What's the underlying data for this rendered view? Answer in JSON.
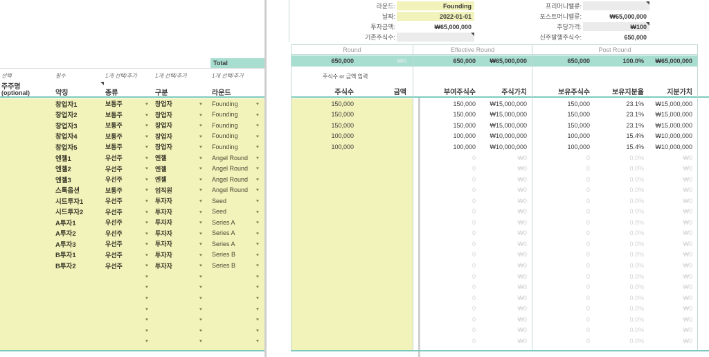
{
  "app": {
    "type": "spreadsheet",
    "colors": {
      "teal_band": "#a8ded0",
      "teal_rule": "#7ecbbd",
      "yellow_input": "#f2f2bb",
      "gray_input": "#ebebeb",
      "muted_text": "#c9c9c9"
    }
  },
  "round_panel": {
    "fields": [
      {
        "label": "라운드:",
        "value": "Founding",
        "style": "yellow",
        "dropdown": true
      },
      {
        "label": "날짜:",
        "value": "2022-01-01",
        "style": "yellow",
        "dropdown": false
      },
      {
        "label": "투자금액:",
        "value": "₩65,000,000",
        "style": "plain",
        "dropdown": false
      },
      {
        "label": "기존주식수:",
        "value": "",
        "style": "gray",
        "dropdown": false,
        "comment": true
      }
    ]
  },
  "valuation_panel": {
    "fields": [
      {
        "label": "프리머니밸류:",
        "value": "",
        "style": "gray",
        "comment": true
      },
      {
        "label": "포스트머니밸류:",
        "value": "₩65,000,000",
        "style": "plain",
        "comment": false
      },
      {
        "label": "주당가격:",
        "value": "₩100",
        "style": "gray",
        "comment": true
      },
      {
        "label": "신주발행주식수:",
        "value": "650,000",
        "style": "plain",
        "comment": false
      }
    ]
  },
  "left_headers": {
    "total_label": "Total",
    "hints": {
      "select": "선택",
      "required": "필수",
      "pick_or_add": "1개 선택/추가"
    },
    "columns": [
      {
        "hint": "선택",
        "title": "주주명",
        "subtitle": "(optional)"
      },
      {
        "hint": "필수",
        "title": "약칭",
        "subtitle": ""
      },
      {
        "hint": "1개 선택/추가",
        "title": "종류",
        "subtitle": ""
      },
      {
        "hint": "1개 선택/추가",
        "title": "구분",
        "subtitle": ""
      },
      {
        "hint": "1개 선택/추가",
        "title": "라운드",
        "subtitle": ""
      }
    ]
  },
  "groups": [
    {
      "name": "Round"
    },
    {
      "name": "Effective Round"
    },
    {
      "name": "Post Round"
    }
  ],
  "totals": {
    "round_shares": "650,000",
    "round_amount": "₩0",
    "effective_shares": "650,000",
    "effective_value": "₩65,000,000",
    "post_shares": "650,000",
    "post_percent": "100.0%",
    "post_value": "₩65,000,000"
  },
  "input_hint": "주식수 or 금액 입력",
  "right_headers": [
    "주식수",
    "금액",
    "부여주식수",
    "주식가치",
    "보유주식수",
    "보유지분율",
    "지분가치"
  ],
  "rows": [
    {
      "name": "창업자1",
      "kind": "보통주",
      "category": "창업자",
      "round": "Founding",
      "shares": "150,000",
      "amount": "",
      "eff_shares": "150,000",
      "eff_value": "₩15,000,000",
      "post_shares": "150,000",
      "post_percent": "23.1%",
      "post_value": "₩15,000,000",
      "empty": false
    },
    {
      "name": "창업자2",
      "kind": "보통주",
      "category": "창업자",
      "round": "Founding",
      "shares": "150,000",
      "amount": "",
      "eff_shares": "150,000",
      "eff_value": "₩15,000,000",
      "post_shares": "150,000",
      "post_percent": "23.1%",
      "post_value": "₩15,000,000",
      "empty": false
    },
    {
      "name": "창업자3",
      "kind": "보통주",
      "category": "창업자",
      "round": "Founding",
      "shares": "150,000",
      "amount": "",
      "eff_shares": "150,000",
      "eff_value": "₩15,000,000",
      "post_shares": "150,000",
      "post_percent": "23.1%",
      "post_value": "₩15,000,000",
      "empty": false
    },
    {
      "name": "창업자4",
      "kind": "보통주",
      "category": "창업자",
      "round": "Founding",
      "shares": "100,000",
      "amount": "",
      "eff_shares": "100,000",
      "eff_value": "₩10,000,000",
      "post_shares": "100,000",
      "post_percent": "15.4%",
      "post_value": "₩10,000,000",
      "empty": false
    },
    {
      "name": "창업자5",
      "kind": "보통주",
      "category": "창업자",
      "round": "Founding",
      "shares": "100,000",
      "amount": "",
      "eff_shares": "100,000",
      "eff_value": "₩10,000,000",
      "post_shares": "100,000",
      "post_percent": "15.4%",
      "post_value": "₩10,000,000",
      "empty": false
    },
    {
      "name": "엔젤1",
      "kind": "우선주",
      "category": "엔젤",
      "round": "Angel Round",
      "shares": "",
      "amount": "",
      "eff_shares": "0",
      "eff_value": "₩0",
      "post_shares": "0",
      "post_percent": "0.0%",
      "post_value": "₩0",
      "empty": true
    },
    {
      "name": "엔젤2",
      "kind": "우선주",
      "category": "엔젤",
      "round": "Angel Round",
      "shares": "",
      "amount": "",
      "eff_shares": "0",
      "eff_value": "₩0",
      "post_shares": "0",
      "post_percent": "0.0%",
      "post_value": "₩0",
      "empty": true
    },
    {
      "name": "엔젤3",
      "kind": "우선주",
      "category": "엔젤",
      "round": "Angel Round",
      "shares": "",
      "amount": "",
      "eff_shares": "0",
      "eff_value": "₩0",
      "post_shares": "0",
      "post_percent": "0.0%",
      "post_value": "₩0",
      "empty": true
    },
    {
      "name": "스톡옵션",
      "kind": "보통주",
      "category": "임직원",
      "round": "Angel Round",
      "shares": "",
      "amount": "",
      "eff_shares": "0",
      "eff_value": "₩0",
      "post_shares": "0",
      "post_percent": "0.0%",
      "post_value": "₩0",
      "empty": true
    },
    {
      "name": "시드투자1",
      "kind": "우선주",
      "category": "투자자",
      "round": "Seed",
      "shares": "",
      "amount": "",
      "eff_shares": "0",
      "eff_value": "₩0",
      "post_shares": "0",
      "post_percent": "0.0%",
      "post_value": "₩0",
      "empty": true
    },
    {
      "name": "시드투자2",
      "kind": "우선주",
      "category": "투자자",
      "round": "Seed",
      "shares": "",
      "amount": "",
      "eff_shares": "0",
      "eff_value": "₩0",
      "post_shares": "0",
      "post_percent": "0.0%",
      "post_value": "₩0",
      "empty": true
    },
    {
      "name": "A투자1",
      "kind": "우선주",
      "category": "투자자",
      "round": "Series A",
      "shares": "",
      "amount": "",
      "eff_shares": "0",
      "eff_value": "₩0",
      "post_shares": "0",
      "post_percent": "0.0%",
      "post_value": "₩0",
      "empty": true
    },
    {
      "name": "A투자2",
      "kind": "우선주",
      "category": "투자자",
      "round": "Series A",
      "shares": "",
      "amount": "",
      "eff_shares": "0",
      "eff_value": "₩0",
      "post_shares": "0",
      "post_percent": "0.0%",
      "post_value": "₩0",
      "empty": true
    },
    {
      "name": "A투자3",
      "kind": "우선주",
      "category": "투자자",
      "round": "Series A",
      "shares": "",
      "amount": "",
      "eff_shares": "0",
      "eff_value": "₩0",
      "post_shares": "0",
      "post_percent": "0.0%",
      "post_value": "₩0",
      "empty": true
    },
    {
      "name": "B투자1",
      "kind": "우선주",
      "category": "투자자",
      "round": "Series B",
      "shares": "",
      "amount": "",
      "eff_shares": "0",
      "eff_value": "₩0",
      "post_shares": "0",
      "post_percent": "0.0%",
      "post_value": "₩0",
      "empty": true
    },
    {
      "name": "B투자2",
      "kind": "우선주",
      "category": "투자자",
      "round": "Series B",
      "shares": "",
      "amount": "",
      "eff_shares": "0",
      "eff_value": "₩0",
      "post_shares": "0",
      "post_percent": "0.0%",
      "post_value": "₩0",
      "empty": true
    },
    {
      "name": "",
      "kind": "",
      "category": "",
      "round": "",
      "shares": "",
      "amount": "",
      "eff_shares": "0",
      "eff_value": "₩0",
      "post_shares": "0",
      "post_percent": "0.0%",
      "post_value": "₩0",
      "empty": true
    },
    {
      "name": "",
      "kind": "",
      "category": "",
      "round": "",
      "shares": "",
      "amount": "",
      "eff_shares": "0",
      "eff_value": "₩0",
      "post_shares": "0",
      "post_percent": "0.0%",
      "post_value": "₩0",
      "empty": true
    },
    {
      "name": "",
      "kind": "",
      "category": "",
      "round": "",
      "shares": "",
      "amount": "",
      "eff_shares": "0",
      "eff_value": "₩0",
      "post_shares": "0",
      "post_percent": "0.0%",
      "post_value": "₩0",
      "empty": true
    },
    {
      "name": "",
      "kind": "",
      "category": "",
      "round": "",
      "shares": "",
      "amount": "",
      "eff_shares": "0",
      "eff_value": "₩0",
      "post_shares": "0",
      "post_percent": "0.0%",
      "post_value": "₩0",
      "empty": true
    },
    {
      "name": "",
      "kind": "",
      "category": "",
      "round": "",
      "shares": "",
      "amount": "",
      "eff_shares": "0",
      "eff_value": "₩0",
      "post_shares": "0",
      "post_percent": "0.0%",
      "post_value": "₩0",
      "empty": true
    },
    {
      "name": "",
      "kind": "",
      "category": "",
      "round": "",
      "shares": "",
      "amount": "",
      "eff_shares": "0",
      "eff_value": "₩0",
      "post_shares": "0",
      "post_percent": "0.0%",
      "post_value": "₩0",
      "empty": true
    },
    {
      "name": "",
      "kind": "",
      "category": "",
      "round": "",
      "shares": "",
      "amount": "",
      "eff_shares": "0",
      "eff_value": "₩0",
      "post_shares": "0",
      "post_percent": "0.0%",
      "post_value": "₩0",
      "empty": true
    }
  ]
}
